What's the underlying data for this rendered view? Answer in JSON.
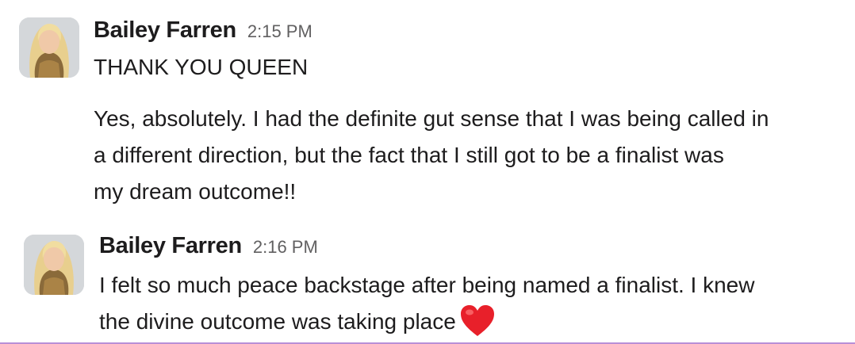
{
  "messages": [
    {
      "author": "Bailey Farren",
      "time": "2:15 PM",
      "paragraphs": [
        "THANK YOU QUEEN",
        "Yes, absolutely. I had the definite gut sense that I was being called in\na different direction, but the fact that I still got to be a finalist was\nmy dream outcome!!"
      ]
    },
    {
      "author": "Bailey Farren",
      "time": "2:16 PM",
      "paragraphs": [
        "I felt so much peace backstage after being named a finalist. I knew\nthe divine outcome was taking place"
      ],
      "emoji": "heart-emoji"
    }
  ],
  "colors": {
    "author": "#1d1c1d",
    "timestamp": "#616061",
    "heart": "#e8202a",
    "divider": "#b98fd6"
  }
}
